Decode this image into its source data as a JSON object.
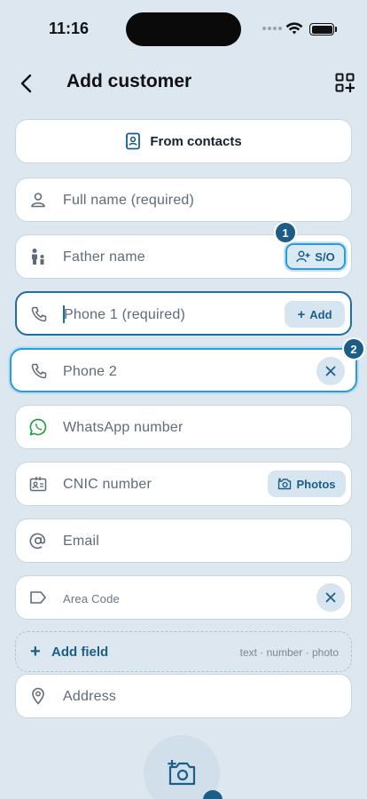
{
  "status_bar": {
    "time": "11:16"
  },
  "header": {
    "title": "Add customer"
  },
  "from_contacts": {
    "label": "From contacts"
  },
  "fields": {
    "full_name": {
      "placeholder": "Full name (required)"
    },
    "father_name": {
      "placeholder": "Father name",
      "action_label": "S/O",
      "badge": "1"
    },
    "phone1": {
      "placeholder": "Phone 1 (required)",
      "action_label": "Add"
    },
    "phone2": {
      "value": "Phone 2",
      "badge": "2"
    },
    "whatsapp": {
      "placeholder": "WhatsApp number"
    },
    "cnic": {
      "placeholder": "CNIC number",
      "action_label": "Photos"
    },
    "email": {
      "placeholder": "Email"
    },
    "area_code": {
      "label": "Area Code"
    },
    "address": {
      "placeholder": "Address"
    }
  },
  "add_field": {
    "label": "Add field",
    "hint": "text · number · photo"
  },
  "colors": {
    "accent": "#1b5f88",
    "background": "#dde7ef",
    "whatsapp": "#25a244"
  },
  "icons": [
    "back-arrow-icon",
    "qr-add-icon",
    "contacts-book-icon",
    "person-icon",
    "parent-child-icon",
    "phone-icon",
    "whatsapp-icon",
    "id-card-icon",
    "at-sign-icon",
    "tag-icon",
    "location-pin-icon",
    "camera-add-icon",
    "close-icon"
  ]
}
